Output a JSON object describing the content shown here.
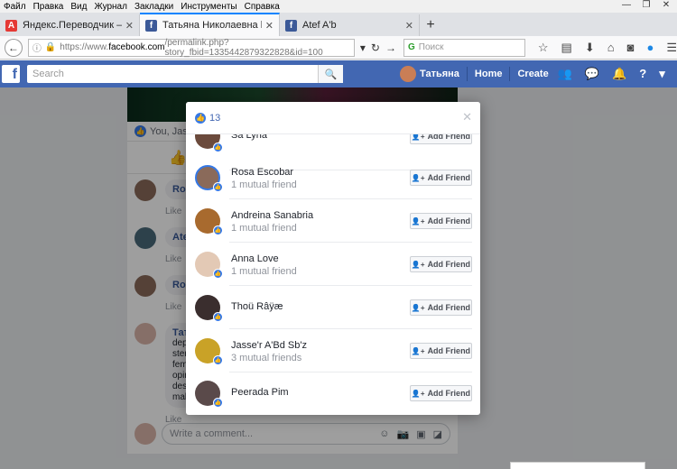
{
  "browser": {
    "menu": [
      "Файл",
      "Правка",
      "Вид",
      "Журнал",
      "Закладки",
      "Инструменты",
      "Справка"
    ],
    "tabs": [
      {
        "title": "Яндекс.Переводчик – сло...",
        "icon": "yandex-translate-icon",
        "active": false
      },
      {
        "title": "Татьяна Николаевна liked...",
        "icon": "facebook-icon",
        "active": true
      },
      {
        "title": "Atef A'b",
        "icon": "facebook-icon",
        "active": false
      }
    ],
    "url_prefix": "https://www.",
    "url_host": "facebook.com",
    "url_path": "/permalink.php?story_fbid=1335442879322828&id=100",
    "search_placeholder": "Поиск"
  },
  "fb": {
    "search_placeholder": "Search",
    "user_name": "Татьяна",
    "nav_home": "Home",
    "nav_create": "Create"
  },
  "post": {
    "reactions_text": "You, Jass",
    "comments": [
      {
        "name": "Rosa",
        "action": "Like"
      },
      {
        "name": "Atef",
        "action": "Like"
      },
      {
        "name": "Rosa",
        "action": "Like"
      },
      {
        "name": "Тать",
        "text": [
          "depe",
          "stere",
          "fema",
          "opini",
          "desir",
          "make"
        ],
        "action": "Like"
      }
    ],
    "write_comment_placeholder": "Write a comment..."
  },
  "modal": {
    "like_count": "13",
    "add_friend_label": "Add Friend",
    "people": [
      {
        "name": "Sa Lyna",
        "mutual": "",
        "color": "#6b4a3c"
      },
      {
        "name": "Rosa Escobar",
        "mutual": "1 mutual friend",
        "color": "#8a6a5a"
      },
      {
        "name": "Andreina Sanabria",
        "mutual": "1 mutual friend",
        "color": "#a86a2e"
      },
      {
        "name": "Anna Love",
        "mutual": "1 mutual friend",
        "color": "#e3c9b5"
      },
      {
        "name": "Thoü Râÿæ",
        "mutual": "",
        "color": "#3a2e2e"
      },
      {
        "name": "Jasse'r A'Bd Sb'z",
        "mutual": "3 mutual friends",
        "color": "#c9a227"
      },
      {
        "name": "Peerada Pim",
        "mutual": "",
        "color": "#5a4a4a"
      }
    ]
  }
}
